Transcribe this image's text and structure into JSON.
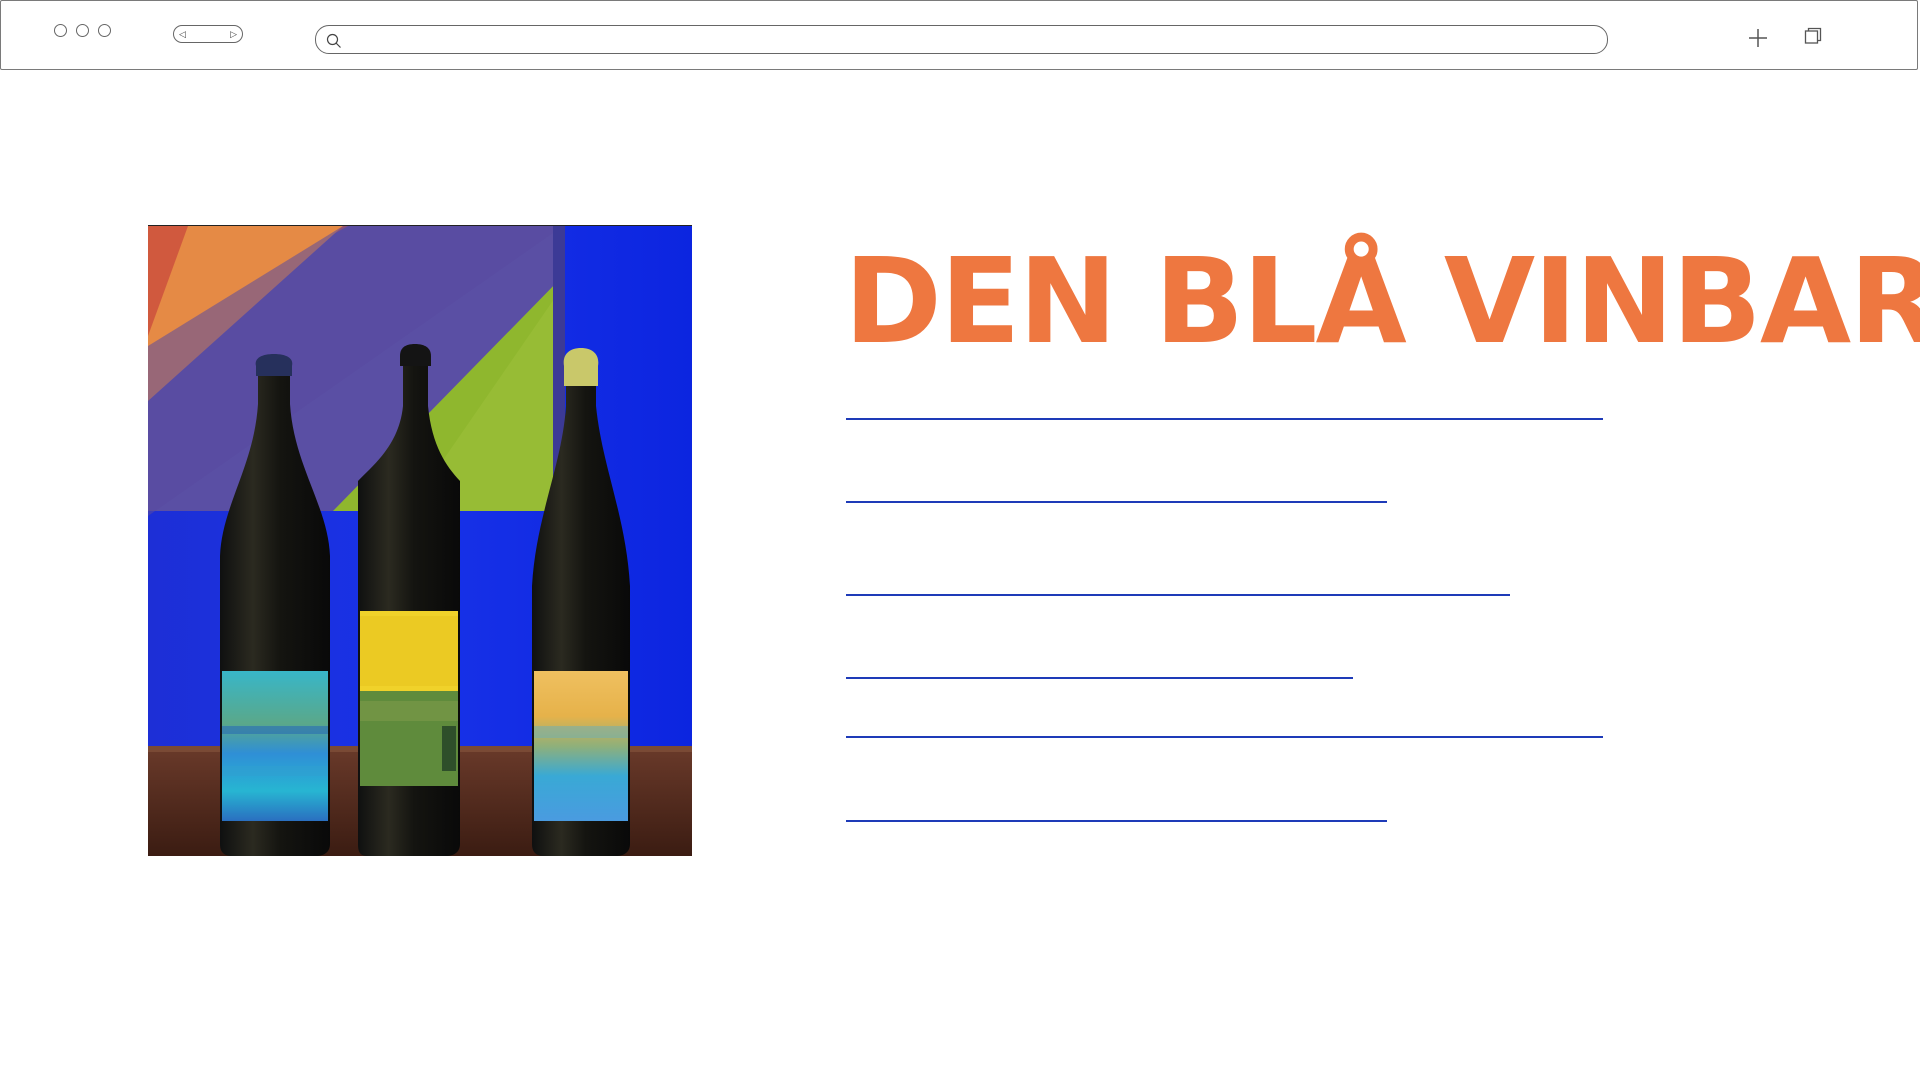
{
  "browser": {
    "address": {
      "value": "",
      "placeholder": ""
    },
    "icons": {
      "search": "search-icon",
      "back": "back-arrow-icon",
      "forward": "forward-arrow-icon",
      "new_tab": "plus-icon",
      "tabs": "tabs-icon"
    },
    "back_glyph": "◁",
    "forward_glyph": "▷"
  },
  "page": {
    "title": "DEN BLÅ VINBAR",
    "title_color": "#ee7740",
    "link_color": "#1e3bb8",
    "image": {
      "alt": "Three wine bottles with watercolor labels in front of a blue wall and painting"
    },
    "links_count": 6
  }
}
